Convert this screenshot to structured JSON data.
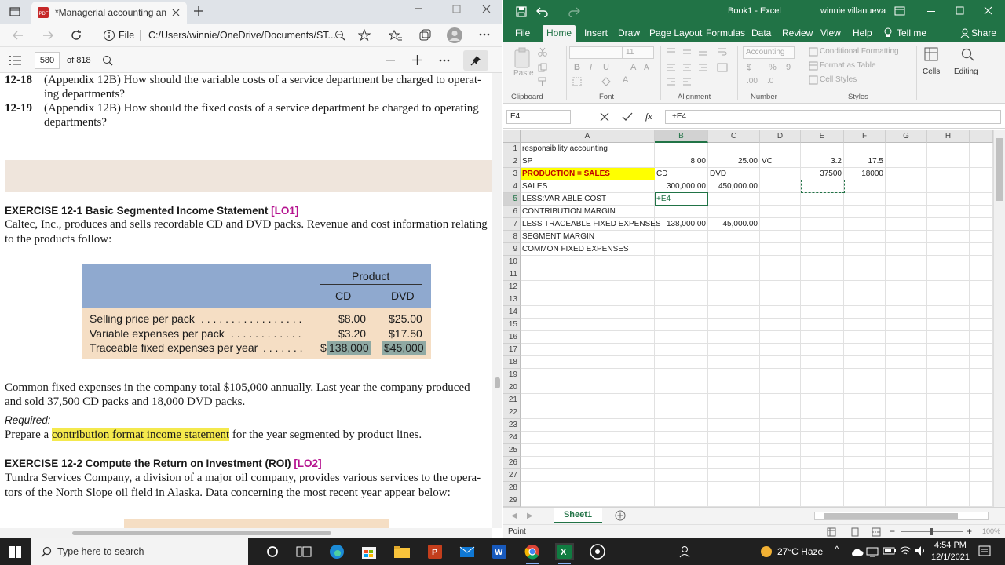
{
  "edge": {
    "tab_title": "*Managerial accounting annotat",
    "address_label": "File",
    "address_path": "C:/Users/winnie/OneDrive/Documents/ST...",
    "page_number": "580",
    "page_total": "of 818"
  },
  "pdf": {
    "q1_num": "12-18",
    "q1_line1": "(Appendix 12B) How should the variable costs of a service department be charged to operat-",
    "q1_line2": "ing departments?",
    "q2_num": "12-19",
    "q2_line1": "(Appendix 12B) How should the fixed costs of a service department be charged to operating",
    "q2_line2": "departments?",
    "ex1_title": "EXERCISE 12-1 Basic Segmented Income Statement",
    "ex1_lo": "[LO1]",
    "ex1_line1": "Caltec, Inc., produces and sells recordable CD and DVD packs. Revenue and cost information relating",
    "ex1_line2": "to the products follow:",
    "table": {
      "product_header": "Product",
      "col_cd": "CD",
      "col_dvd": "DVD",
      "rows": [
        {
          "label": "Selling price per pack",
          "dots": ". . . . . . . . . . . . . . . . .",
          "cd": "$8.00",
          "dvd": "$25.00"
        },
        {
          "label": "Variable expenses per pack",
          "dots": ". . . . . . . . . . . .",
          "cd": "$3.20",
          "dvd": "$17.50"
        },
        {
          "label": "Traceable fixed expenses per year",
          "dots": ". . . . . . .",
          "cd_prefix": "$",
          "cd": "138,000",
          "dvd": "$45,000"
        }
      ]
    },
    "common_line1": "Common fixed expenses in the company total $105,000 annually. Last year the company produced",
    "common_line2": "and sold 37,500 CD packs and 18,000 DVD packs.",
    "required_label": "Required:",
    "prepare_pre": "Prepare a ",
    "prepare_hl": "contribution format income statement",
    "prepare_post": " for the year segmented by product lines.",
    "ex2_title": "EXERCISE 12-2 Compute the Return on Investment (ROI)",
    "ex2_lo": "[LO2]",
    "ex2_line1": "Tundra Services Company, a division of a major oil company, provides various services to the opera-",
    "ex2_line2": "tors of the North Slope oil field in Alaska. Data concerning the most recent year appear below:"
  },
  "excel": {
    "title": "Book1 - Excel",
    "user": "winnie villanueva",
    "ribbon_tabs": [
      "File",
      "Home",
      "Insert",
      "Draw",
      "Page Layout",
      "Formulas",
      "Data",
      "Review",
      "View",
      "Help"
    ],
    "tell_me": "Tell me",
    "share": "Share",
    "font_name": "",
    "font_size": "11",
    "number_format": "Accounting",
    "cond_format": "Conditional Formatting",
    "format_table": "Format as Table",
    "cell_styles": "Cell Styles",
    "cells_label": "Cells",
    "editing_label": "Editing",
    "paste_label": "Paste",
    "groups": [
      "Clipboard",
      "Font",
      "Alignment",
      "Number",
      "Styles"
    ],
    "name_box": "E4",
    "formula": "+E4",
    "columns": [
      "A",
      "B",
      "C",
      "D",
      "E",
      "F",
      "G",
      "H",
      "I"
    ],
    "rows": [
      "1",
      "2",
      "3",
      "4",
      "5",
      "6",
      "7",
      "8",
      "9",
      "10",
      "11",
      "12",
      "13",
      "14",
      "15",
      "16",
      "17",
      "18",
      "19",
      "20",
      "21",
      "22",
      "23",
      "24",
      "25",
      "26",
      "27",
      "28",
      "29"
    ],
    "cells": {
      "A1": "responsibility accounting",
      "A2": "SP",
      "B2": "8.00",
      "C2": "25.00",
      "D2": "VC",
      "E2": "3.2",
      "F2": "17.5",
      "A3": "PRODUCTION = SALES",
      "B3": "CD",
      "C3": "DVD",
      "E3": "37500",
      "F3": "18000",
      "A4": "SALES",
      "B4": "300,000.00",
      "C4": "450,000.00",
      "A5": "LESS:VARIABLE COST",
      "B5": "+E4",
      "A6": "CONTRIBUTION MARGIN",
      "A7": "LESS TRACEABLE FIXED EXPENSES",
      "B7": "138,000.00",
      "C7": "45,000.00",
      "A8": "SEGMENT MARGIN",
      "A9": "COMMON FIXED EXPENSES"
    },
    "sheet_tab": "Sheet1",
    "status_mode": "Point",
    "zoom": "100%",
    "highlight_color": "#ffff00"
  },
  "taskbar": {
    "search_placeholder": "Type here to search",
    "weather": "27°C Haze",
    "time": "4:54 PM",
    "date": "12/1/2021"
  }
}
